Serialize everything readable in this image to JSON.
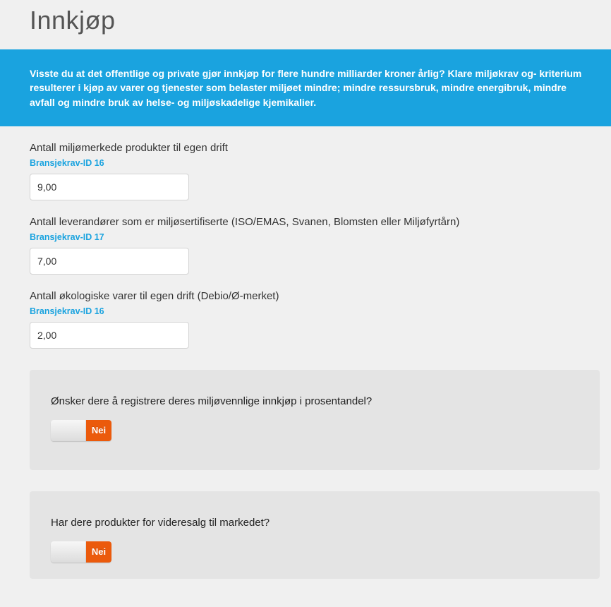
{
  "page": {
    "title": "Innkjøp"
  },
  "banner": {
    "text": "Visste du at det offentlige og private gjør innkjøp for flere hundre milliarder kroner årlig? Klare miljøkrav og- kriterium resulterer i kjøp av varer og tjenester som belaster miljøet mindre; mindre ressursbruk, mindre energibruk, mindre avfall og mindre bruk av helse- og miljøskadelige kjemikalier."
  },
  "fields": {
    "f1": {
      "label": "Antall miljømerkede produkter til egen drift",
      "meta": "Bransjekrav-ID 16",
      "value": "9,00"
    },
    "f2": {
      "label": "Antall leverandører som er miljøsertifiserte (ISO/EMAS, Svanen, Blomsten eller Miljøfyrtårn)",
      "meta": "Bransjekrav-ID 17",
      "value": "7,00"
    },
    "f3": {
      "label": "Antall økologiske varer til egen drift (Debio/Ø-merket)",
      "meta": "Bransjekrav-ID 16",
      "value": "2,00"
    }
  },
  "panels": {
    "p1": {
      "question": "Ønsker dere å registrere deres miljøvennlige innkjøp i prosentandel?",
      "toggle_state": "Nei"
    },
    "p2": {
      "question": "Har dere produkter for videresalg til markedet?",
      "toggle_state": "Nei"
    }
  }
}
